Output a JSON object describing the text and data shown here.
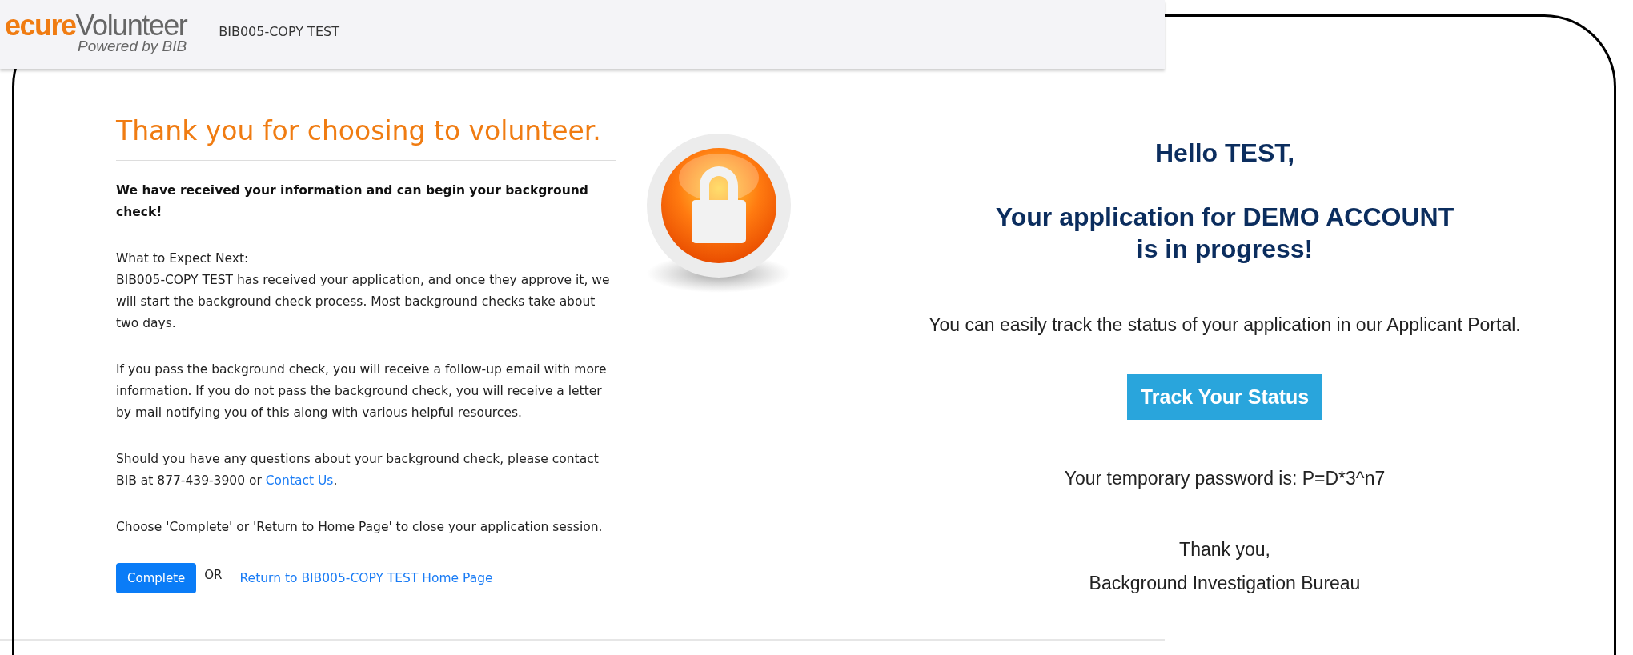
{
  "header": {
    "logo": {
      "brand_part_1": "ecure",
      "brand_part_2": "Volunteer",
      "tagline": "Powered by BIB"
    },
    "org_name": "BIB005-COPY TEST"
  },
  "confirmation": {
    "heading": "Thank you for choosing to volunteer.",
    "lead": "We have received your information and can begin your background check!",
    "expect_title": "What to Expect Next:",
    "paragraphs": [
      "BIB005-COPY TEST has received your application, and once they approve it, we will start the background check process. Most background checks take about two days.",
      "If you pass the background check, you will receive a follow-up email with more information. If you do not pass the background check, you will receive a letter by mail notifying you of this along with various helpful resources."
    ],
    "contact": {
      "text": "Should you have any questions about your background check, please contact BIB at 877-439-3900 or ",
      "link": "Contact Us",
      "after": "."
    },
    "closing_note": "Choose 'Complete' or 'Return to Home Page' to close your application session.",
    "actions": {
      "complete_button": "Complete",
      "separator": "OR",
      "home_link": "Return to BIB005-COPY TEST Home Page"
    }
  },
  "email": {
    "greeting": "Hello TEST,",
    "status_lines": [
      "Your application for DEMO ACCOUNT",
      "is in progress!"
    ],
    "message": "You can easily track the status of your application in our Applicant Portal.",
    "button": "Track Your Status",
    "password": "Your temporary password is: P=D*3^n7",
    "closing": "Thank you,",
    "signature": "Background Investigation Bureau"
  }
}
